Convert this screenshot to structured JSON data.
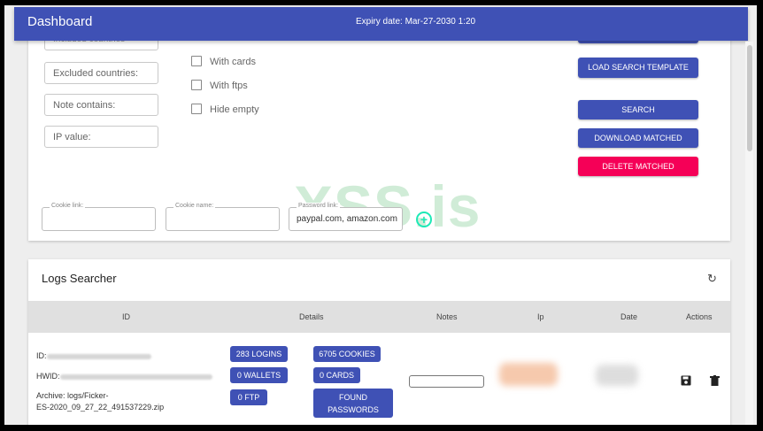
{
  "appbar": {
    "title": "Dashboard",
    "expiry": "Expiry date: Mar-27-2030 1:20"
  },
  "filters": {
    "included_countries_placeholder": "Included countries",
    "excluded_countries_placeholder": "Excluded countries:",
    "note_contains_placeholder": "Note contains:",
    "ip_value_placeholder": "IP value:",
    "checkbox_cards": "With cards",
    "checkbox_ftps": "With ftps",
    "checkbox_hide_empty": "Hide empty",
    "cookie_link_label": "Cookie link:",
    "cookie_name_label": "Cookie name:",
    "password_link_label": "Password link:",
    "password_link_value": "paypal.com, amazon.com",
    "add_icon": "plus-circle-icon"
  },
  "actions": {
    "load_template": "LOAD SEARCH TEMPLATE",
    "search": "SEARCH",
    "download": "DOWNLOAD MATCHED",
    "delete": "DELETE MATCHED"
  },
  "watermark": "XSS.is",
  "logs": {
    "title": "Logs Searcher",
    "refresh_icon": "refresh-icon",
    "columns": [
      "ID",
      "Details",
      "Notes",
      "Ip",
      "Date",
      "Actions"
    ],
    "row": {
      "id_label": "ID:",
      "hwid_label": "HWID:",
      "archive_label": "Archive: logs/Ficker-",
      "archive_line2": "ES-2020_09_27_22_491537229.zip",
      "logins": "283 LOGINS",
      "cookies": "6705 COOKIES",
      "wallets": "0 WALLETS",
      "cards": "0 CARDS",
      "ftp": "0 FTP",
      "found_passwords_1": "FOUND",
      "found_passwords_2": "PASSWORDS",
      "save_icon": "save-icon",
      "delete_icon": "trash-icon"
    }
  },
  "colors": {
    "primary": "#3f51b5",
    "danger": "#f50057",
    "accent": "#1de9b6"
  }
}
